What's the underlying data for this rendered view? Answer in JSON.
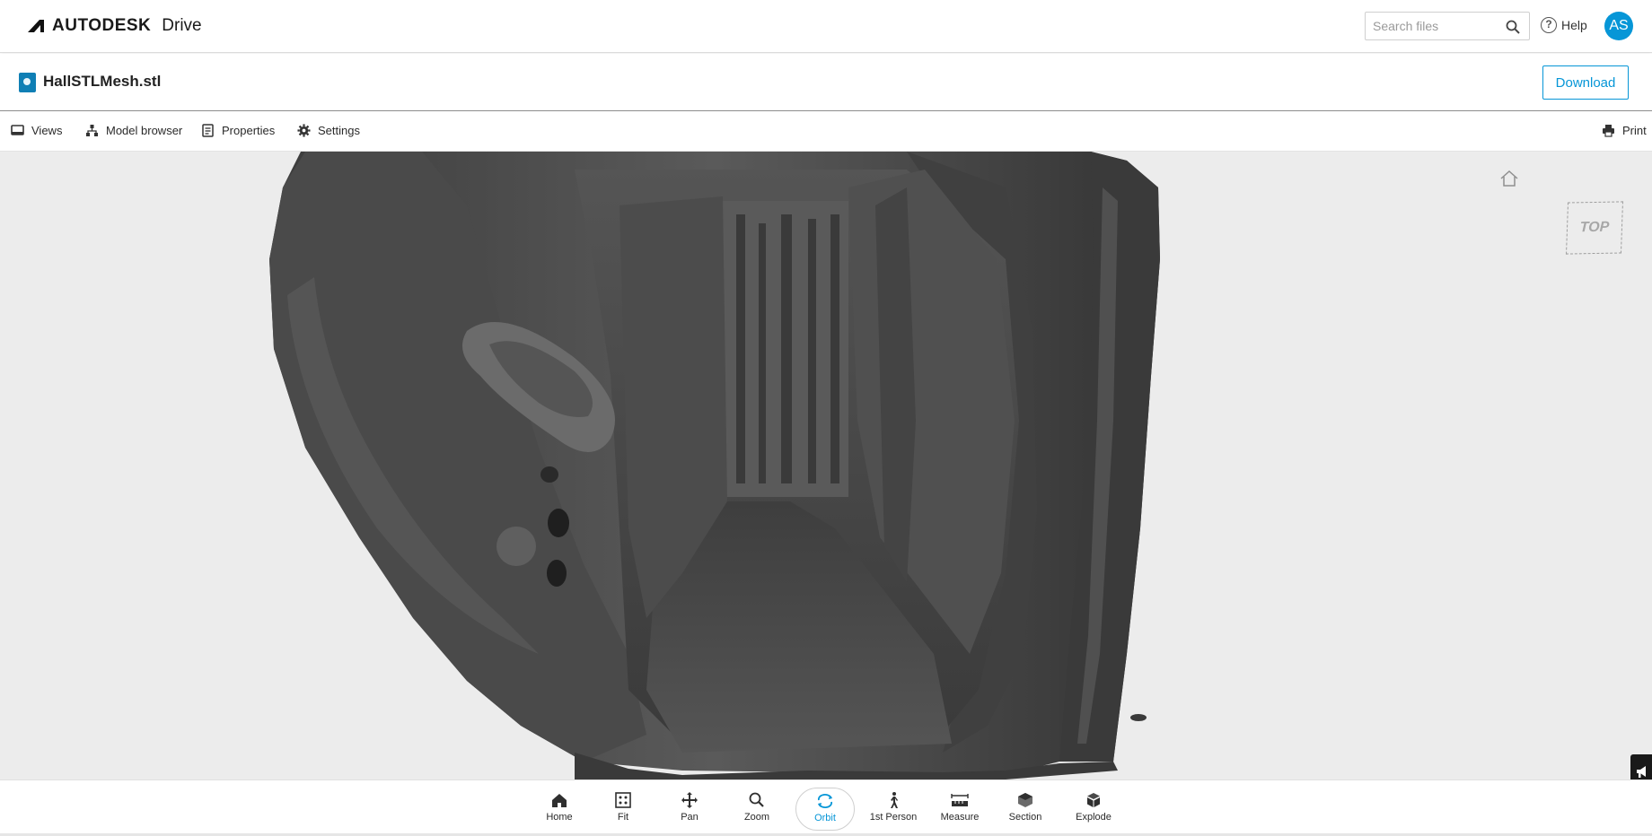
{
  "header": {
    "brand_name": "AUTODESK",
    "brand_product": "Drive",
    "search_placeholder": "Search files",
    "help_label": "Help",
    "avatar_initials": "AS"
  },
  "file": {
    "name": "HallSTLMesh.stl",
    "download_label": "Download"
  },
  "toolbar": {
    "views": "Views",
    "model_browser": "Model browser",
    "properties": "Properties",
    "settings": "Settings",
    "print": "Print"
  },
  "viewer": {
    "viewcube_face": "TOP",
    "model_color": "#4a4a4a",
    "background_color": "#ececec"
  },
  "navigation": {
    "items": [
      {
        "label": "Home",
        "icon": "home-icon"
      },
      {
        "label": "Fit",
        "icon": "fit-icon"
      },
      {
        "label": "Pan",
        "icon": "pan-icon"
      },
      {
        "label": "Zoom",
        "icon": "zoom-icon"
      },
      {
        "label": "Orbit",
        "icon": "orbit-icon",
        "active": true
      },
      {
        "label": "1st Person",
        "icon": "first-person-icon"
      },
      {
        "label": "Measure",
        "icon": "measure-icon"
      },
      {
        "label": "Section",
        "icon": "section-icon"
      },
      {
        "label": "Explode",
        "icon": "explode-icon"
      }
    ]
  },
  "colors": {
    "accent": "#0696d7",
    "file_icon": "#0f7fb5"
  }
}
